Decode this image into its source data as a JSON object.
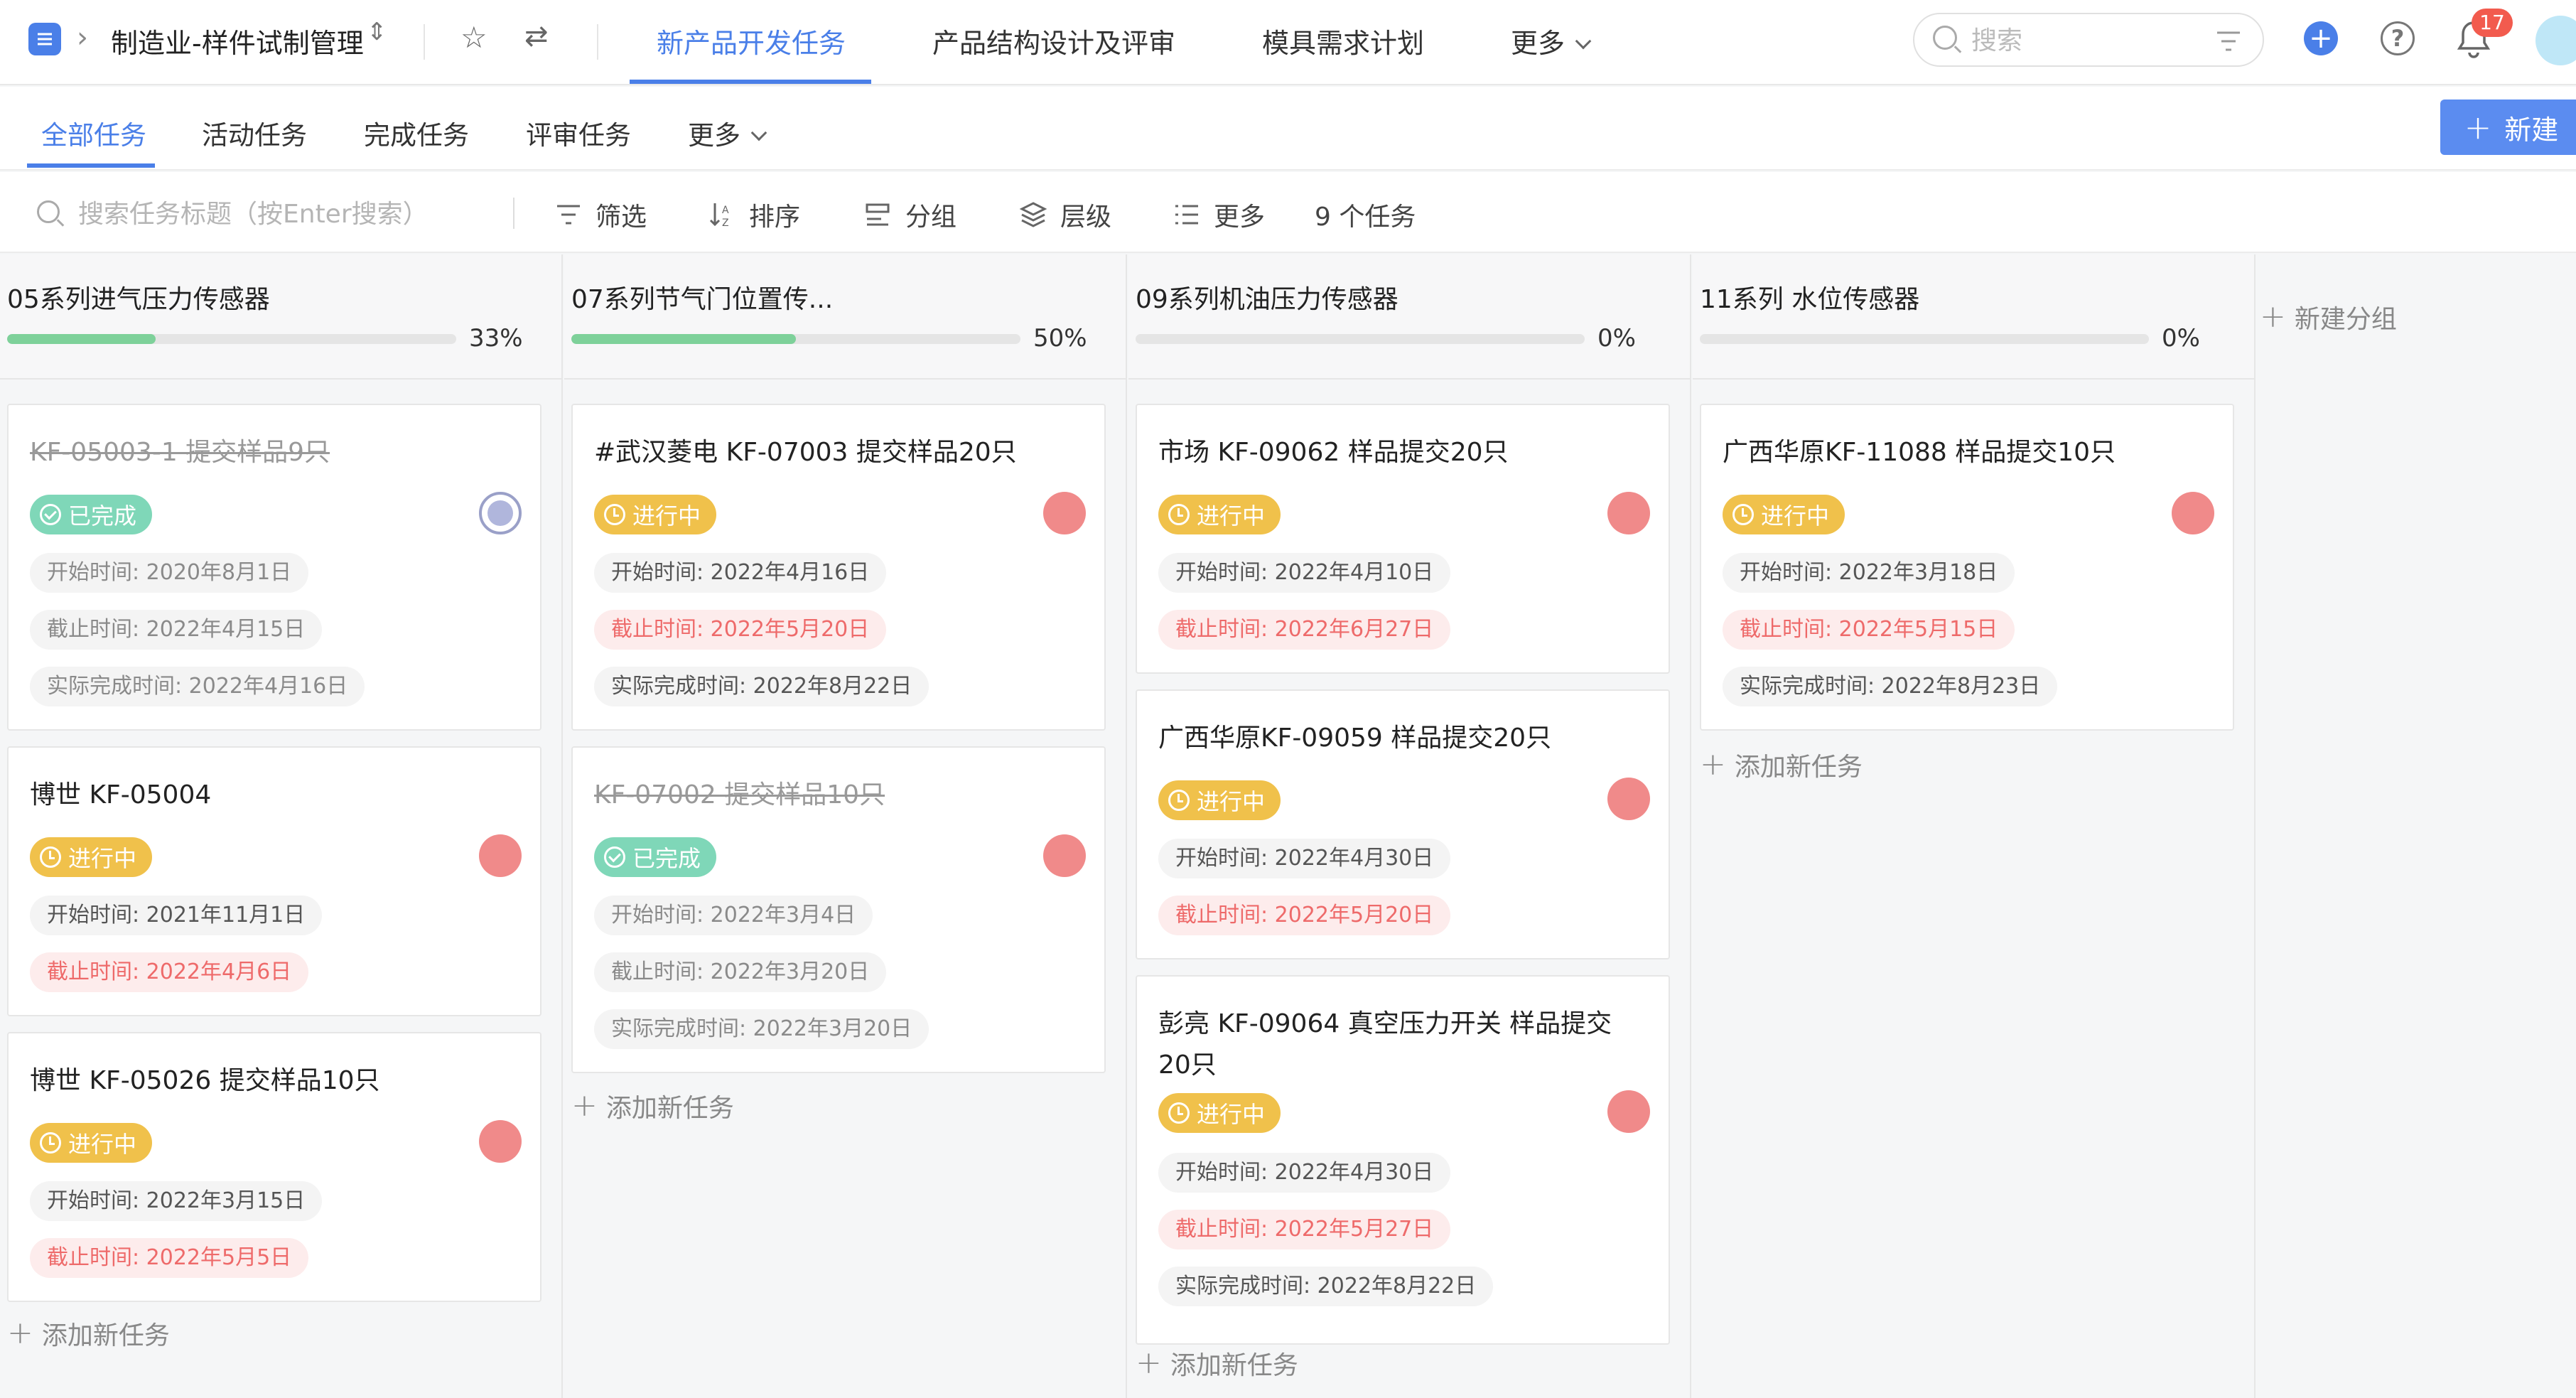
{
  "header": {
    "project_title": "制造业-样件试制管理",
    "tabs": [
      {
        "label": "新产品开发任务",
        "active": true
      },
      {
        "label": "产品结构设计及评审",
        "active": false
      },
      {
        "label": "模具需求计划",
        "active": false
      },
      {
        "label": "更多",
        "active": false
      }
    ],
    "search_placeholder": "搜索",
    "notification_count": "17"
  },
  "subnav": {
    "tabs": [
      {
        "label": "全部任务",
        "active": true
      },
      {
        "label": "活动任务",
        "active": false
      },
      {
        "label": "完成任务",
        "active": false
      },
      {
        "label": "评审任务",
        "active": false
      },
      {
        "label": "更多",
        "active": false
      }
    ],
    "new_button": "新建"
  },
  "toolbar": {
    "search_placeholder": "搜索任务标题（按Enter搜索）",
    "filter": "筛选",
    "sort": "排序",
    "group": "分组",
    "level": "层级",
    "more": "更多",
    "task_count": "9 个任务"
  },
  "board": {
    "add_task_label": "添加新任务",
    "new_group_label": "新建分组",
    "columns": [
      {
        "title": "05系列进气压力传感器",
        "percent": "33%",
        "progress": 0.33,
        "cards": [
          {
            "title": "KF-05003-1 提交样品9只",
            "status": "已完成",
            "start": "开始时间: 2020年8月1日",
            "due": "截止时间: 2022年4月15日",
            "actual": "实际完成时间: 2022年4月16日"
          },
          {
            "title": "博世 KF-05004",
            "status": "进行中",
            "start": "开始时间: 2021年11月1日",
            "due": "截止时间: 2022年4月6日",
            "actual": ""
          },
          {
            "title": "博世 KF-05026 提交样品10只",
            "status": "进行中",
            "start": "开始时间: 2022年3月15日",
            "due": "截止时间: 2022年5月5日",
            "actual": ""
          }
        ]
      },
      {
        "title": "07系列节气门位置传...",
        "percent": "50%",
        "progress": 0.5,
        "cards": [
          {
            "title": "#武汉菱电 KF-07003 提交样品20只",
            "status": "进行中",
            "start": "开始时间: 2022年4月16日",
            "due": "截止时间: 2022年5月20日",
            "actual": "实际完成时间: 2022年8月22日"
          },
          {
            "title": "KF-07002 提交样品10只",
            "status": "已完成",
            "start": "开始时间: 2022年3月4日",
            "due": "截止时间: 2022年3月20日",
            "actual": "实际完成时间: 2022年3月20日"
          }
        ]
      },
      {
        "title": "09系列机油压力传感器",
        "percent": "0%",
        "progress": 0,
        "cards": [
          {
            "title": "市场 KF-09062 样品提交20只",
            "status": "进行中",
            "start": "开始时间: 2022年4月10日",
            "due": "截止时间: 2022年6月27日",
            "actual": ""
          },
          {
            "title": "广西华原KF-09059 样品提交20只",
            "status": "进行中",
            "start": "开始时间: 2022年4月30日",
            "due": "截止时间: 2022年5月20日",
            "actual": ""
          },
          {
            "title": "彭亮 KF-09064 真空压力开关 样品提交20只",
            "status": "进行中",
            "start": "开始时间: 2022年4月30日",
            "due": "截止时间: 2022年5月27日",
            "actual": "实际完成时间: 2022年8月22日"
          }
        ]
      },
      {
        "title": "11系列 水位传感器",
        "percent": "0%",
        "progress": 0,
        "cards": [
          {
            "title": "广西华原KF-11088 样品提交10只",
            "status": "进行中",
            "start": "开始时间: 2022年3月18日",
            "due": "截止时间: 2022年5月15日",
            "actual": "实际完成时间: 2022年8月23日"
          }
        ]
      }
    ]
  }
}
